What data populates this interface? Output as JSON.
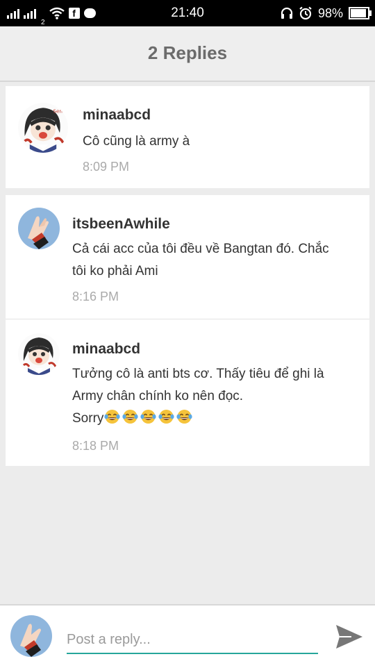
{
  "status_bar": {
    "sim2_label": "2",
    "facebook_glyph": "f",
    "time": "21:40",
    "battery_percent": "98%",
    "battery_level": 0.98,
    "icons": [
      "signal-icon",
      "signal-icon",
      "wifi-icon",
      "facebook-icon",
      "messenger-icon",
      "headset-icon",
      "alarm-icon",
      "battery-icon"
    ]
  },
  "header": {
    "title": "2 Replies"
  },
  "parent": {
    "username": "minaabcd",
    "text": "Cô cũng là army à",
    "time": "8:09 PM",
    "avatar": "anime-girl-avatar"
  },
  "replies": [
    {
      "username": "itsbeenAwhile",
      "lines": [
        "Cả cái acc của tôi đều về Bangtan đó. Chắc",
        "tôi ko phải Ami"
      ],
      "time": "8:16 PM",
      "avatar": "hands-avatar"
    },
    {
      "username": "minaabcd",
      "lines": [
        "Tưởng cô là anti bts cơ. Thấy tiêu để ghi là",
        "Army chân chính ko nên đọc.",
        "Sorry"
      ],
      "emoji": "tears-of-joy-emoji",
      "emoji_count": 5,
      "time": "8:18 PM",
      "avatar": "anime-girl-avatar"
    }
  ],
  "composer": {
    "placeholder": "Post a reply...",
    "value": "",
    "avatar": "hands-avatar",
    "send_icon": "send-icon",
    "accent_color": "#26a69a"
  }
}
